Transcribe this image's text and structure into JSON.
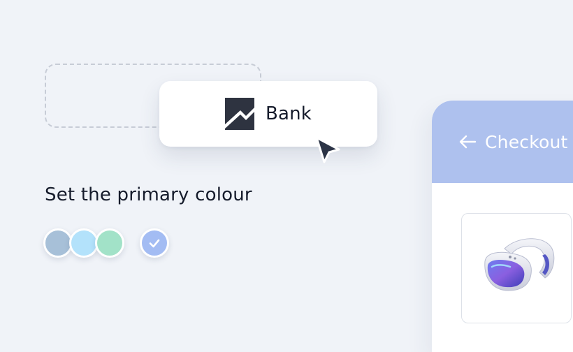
{
  "logo": {
    "name": "Bank",
    "mark_color": "#2e3340"
  },
  "primary_colour": {
    "heading": "Set the primary colour",
    "swatches": [
      {
        "color": "#a7c0d8",
        "selected": false
      },
      {
        "color": "#b3e2fb",
        "selected": false
      },
      {
        "color": "#a2e2c8",
        "selected": false
      },
      {
        "color": "#a3bcf3",
        "selected": true
      }
    ]
  },
  "checkout": {
    "title": "Checkout",
    "header_color": "#aec1ee",
    "back_icon": "arrow-left-icon",
    "product_icon": "vr-headset-icon"
  },
  "cursor_icon": "pointer-cursor-icon"
}
